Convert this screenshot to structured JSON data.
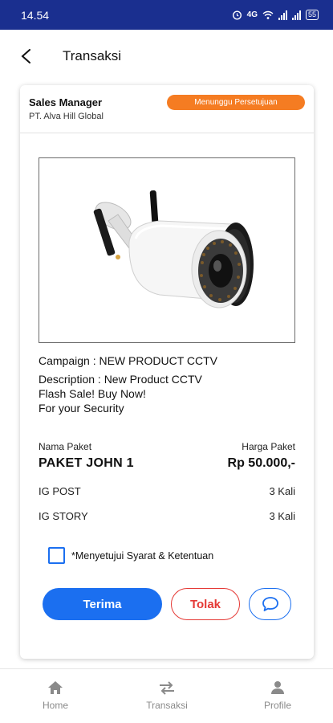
{
  "status_bar": {
    "time": "14.54",
    "network": "4G",
    "battery": "55"
  },
  "app_bar": {
    "title": "Transaksi",
    "back_icon": "arrow-left-icon"
  },
  "card": {
    "role": "Sales Manager",
    "company": "PT. Alva Hill Global",
    "status_badge": "Menunggu Persetujuan",
    "image": "cctv-camera-image",
    "campaign": "Campaign : NEW PRODUCT CCTV",
    "description_lines": [
      "Description : New Product CCTV",
      "Flash Sale! Buy Now!",
      "For your Security"
    ],
    "package_label": "Nama Paket",
    "price_label": "Harga Paket",
    "package_name": "PAKET JOHN 1",
    "package_price": "Rp 50.000,-",
    "items": [
      {
        "name": "IG POST",
        "qty": "3 Kali"
      },
      {
        "name": "IG STORY",
        "qty": "3 Kali"
      }
    ],
    "agree_text": "*Menyetujui Syarat & Ketentuan",
    "accept_label": "Terima",
    "reject_label": "Tolak",
    "chat_icon": "chat-bubble-icon"
  },
  "bottom_nav": {
    "items": [
      {
        "label": "Home",
        "icon": "home-icon"
      },
      {
        "label": "Transaksi",
        "icon": "transfer-icon"
      },
      {
        "label": "Profile",
        "icon": "person-icon"
      }
    ]
  },
  "colors": {
    "status_bar": "#1a2f8f",
    "primary": "#1b6ff0",
    "badge": "#f57c22",
    "reject": "#e53935",
    "nav_inactive": "#8a8a8a"
  }
}
